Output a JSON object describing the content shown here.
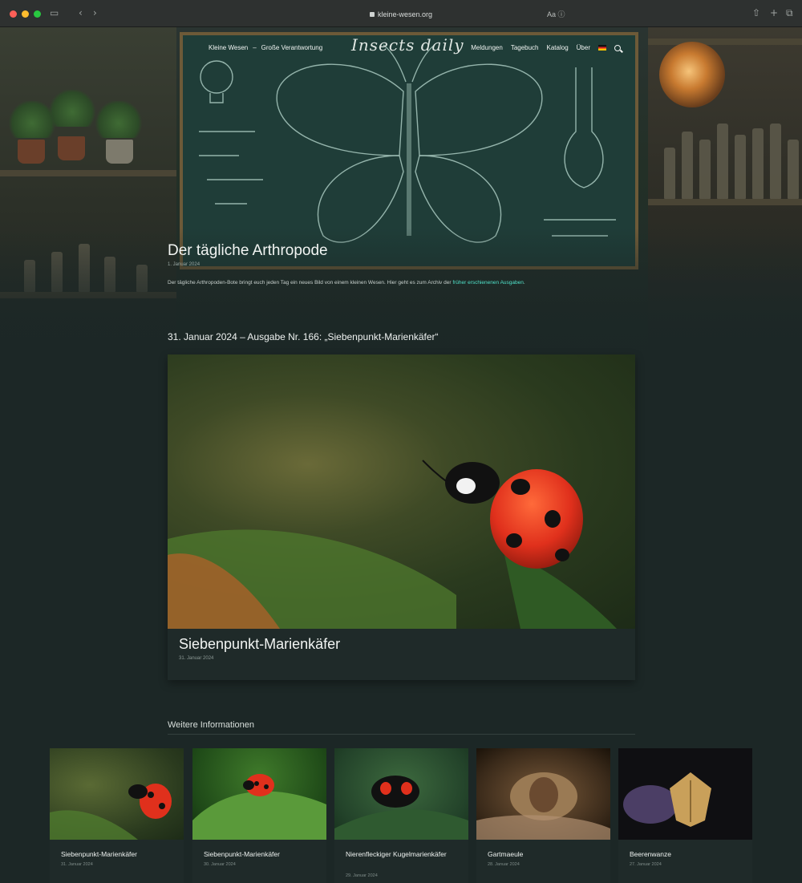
{
  "browser": {
    "url": "kleine-wesen.org",
    "reader_label": "Aa ⓘ",
    "traffic_lights": [
      "#ff5f57",
      "#febc2e",
      "#28c840"
    ],
    "back_label": "‹",
    "forward_label": "›",
    "sidebar_icon": "sidebar-icon",
    "share_icon": "share-icon",
    "new_tab_icon": "plus-icon",
    "tabs_icon": "tabs-icon"
  },
  "nav": {
    "left_items": [
      "Kleine Wesen",
      "Große Verantwortung"
    ],
    "logo": "Insects daily",
    "right_items": [
      "Meldungen",
      "Tagebuch",
      "Katalog",
      "Über"
    ],
    "language_icon": "german-flag-icon"
  },
  "page": {
    "title": "Der tägliche Arthropode",
    "date": "1. Januar 2024",
    "intro": "Der tägliche Arthropoden-Bote bringt euch jeden Tag ein neues Bild von einem kleinen Wesen. Hier geht es zum Archiv der ",
    "intro_link": "früher erschienenen Ausgaben",
    "intro_end": "."
  },
  "issue": {
    "heading": "31. Januar 2024 – Ausgabe Nr. 166: „Siebenpunkt-Marienkäfer“",
    "title": "Siebenpunkt-Marienkäfer",
    "date": "31. Januar 2024"
  },
  "more": {
    "title": "Weitere Informationen",
    "cards": [
      {
        "title": "Siebenpunkt-Marienkäfer",
        "date": "31. Januar 2024",
        "kind": "ladybug-close"
      },
      {
        "title": "Siebenpunkt-Marienkäfer",
        "date": "30. Januar 2024",
        "kind": "ladybug-leaf"
      },
      {
        "title": "Nierenfleckiger Kugelmarienkäfer",
        "date": "29. Januar 2024",
        "kind": "kidney-ladybird"
      },
      {
        "title": "Gartmaeule",
        "date": "28. Januar 2024",
        "kind": "moth"
      },
      {
        "title": "Beerenwanze",
        "date": "27. Januar 2024",
        "kind": "shieldbug"
      }
    ]
  },
  "colors": {
    "accent_link": "#4fe0c8",
    "page_background": "#1c2726",
    "card_background": "#1f2a29",
    "ladybug_red": "#e0301c"
  }
}
